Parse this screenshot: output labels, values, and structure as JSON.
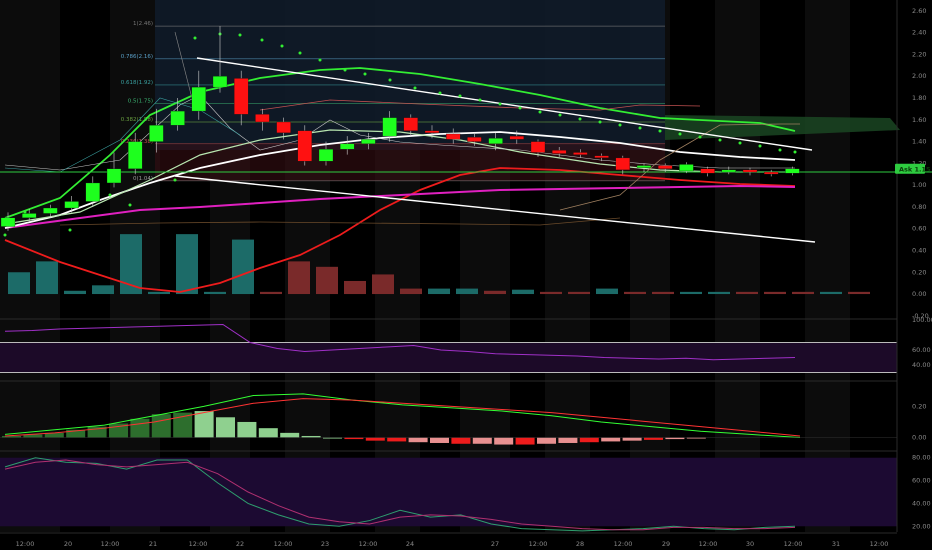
{
  "chart_data": [
    {
      "type": "candlestick",
      "x_ticks": [
        "12:00",
        "20",
        "12:00",
        "21",
        "12:00",
        "22",
        "12:00",
        "23",
        "12:00",
        "24",
        "27",
        "12:00",
        "28",
        "12:00",
        "29",
        "12:00",
        "30",
        "12:00",
        "31",
        "12:00"
      ],
      "y_ticks": [
        "2.60",
        "2.40",
        "2.20",
        "2.00",
        "1.80",
        "1.60",
        "1.40",
        "1.20",
        "1.00",
        "0.80",
        "0.60",
        "0.40",
        "0.20",
        "0.00",
        "-0.20"
      ],
      "ylim": [
        -0.22,
        2.7
      ],
      "candles": [
        {
          "o": 0.62,
          "c": 0.7,
          "h": 0.75,
          "l": 0.58
        },
        {
          "o": 0.7,
          "c": 0.74,
          "h": 0.78,
          "l": 0.66
        },
        {
          "o": 0.74,
          "c": 0.79,
          "h": 0.82,
          "l": 0.7
        },
        {
          "o": 0.79,
          "c": 0.85,
          "h": 0.9,
          "l": 0.75
        },
        {
          "o": 0.85,
          "c": 1.02,
          "h": 1.08,
          "l": 0.8
        },
        {
          "o": 1.02,
          "c": 1.15,
          "h": 1.3,
          "l": 0.98
        },
        {
          "o": 1.15,
          "c": 1.4,
          "h": 1.48,
          "l": 1.1
        },
        {
          "o": 1.4,
          "c": 1.55,
          "h": 1.7,
          "l": 1.3
        },
        {
          "o": 1.55,
          "c": 1.68,
          "h": 1.8,
          "l": 1.5
        },
        {
          "o": 1.68,
          "c": 1.9,
          "h": 2.05,
          "l": 1.6
        },
        {
          "o": 1.9,
          "c": 2.0,
          "h": 2.46,
          "l": 1.85
        },
        {
          "o": 1.98,
          "c": 1.65,
          "h": 2.05,
          "l": 1.55
        },
        {
          "o": 1.65,
          "c": 1.58,
          "h": 1.7,
          "l": 1.5
        },
        {
          "o": 1.58,
          "c": 1.48,
          "h": 1.62,
          "l": 1.42
        },
        {
          "o": 1.5,
          "c": 1.22,
          "h": 1.55,
          "l": 1.18
        },
        {
          "o": 1.22,
          "c": 1.33,
          "h": 1.4,
          "l": 1.18
        },
        {
          "o": 1.33,
          "c": 1.38,
          "h": 1.45,
          "l": 1.28
        },
        {
          "o": 1.38,
          "c": 1.42,
          "h": 1.48,
          "l": 1.33
        },
        {
          "o": 1.45,
          "c": 1.62,
          "h": 1.68,
          "l": 1.4
        },
        {
          "o": 1.62,
          "c": 1.5,
          "h": 1.65,
          "l": 1.45
        },
        {
          "o": 1.5,
          "c": 1.48,
          "h": 1.55,
          "l": 1.43
        },
        {
          "o": 1.47,
          "c": 1.42,
          "h": 1.52,
          "l": 1.38
        },
        {
          "o": 1.44,
          "c": 1.4,
          "h": 1.48,
          "l": 1.36
        },
        {
          "o": 1.38,
          "c": 1.43,
          "h": 1.48,
          "l": 1.32
        },
        {
          "o": 1.45,
          "c": 1.42,
          "h": 1.5,
          "l": 1.38
        },
        {
          "o": 1.4,
          "c": 1.3,
          "h": 1.42,
          "l": 1.26
        },
        {
          "o": 1.32,
          "c": 1.29,
          "h": 1.35,
          "l": 1.26
        },
        {
          "o": 1.3,
          "c": 1.28,
          "h": 1.33,
          "l": 1.25
        },
        {
          "o": 1.27,
          "c": 1.26,
          "h": 1.29,
          "l": 1.22
        },
        {
          "o": 1.25,
          "c": 1.14,
          "h": 1.27,
          "l": 1.1
        },
        {
          "o": 1.16,
          "c": 1.18,
          "h": 1.2,
          "l": 1.12
        },
        {
          "o": 1.18,
          "c": 1.15,
          "h": 1.2,
          "l": 1.12
        },
        {
          "o": 1.13,
          "c": 1.19,
          "h": 1.21,
          "l": 1.11
        },
        {
          "o": 1.15,
          "c": 1.11,
          "h": 1.17,
          "l": 1.08
        },
        {
          "o": 1.12,
          "c": 1.14,
          "h": 1.17,
          "l": 1.1
        },
        {
          "o": 1.14,
          "c": 1.12,
          "h": 1.16,
          "l": 1.09
        },
        {
          "o": 1.12,
          "c": 1.11,
          "h": 1.14,
          "l": 1.08
        },
        {
          "o": 1.11,
          "c": 1.15,
          "h": 1.17,
          "l": 1.09
        }
      ],
      "volume": [
        0.2,
        0.3,
        0.03,
        0.08,
        0.55,
        0.02,
        0.55,
        0.02,
        0.5,
        0.02,
        0.3,
        0.25,
        0.12,
        0.18,
        0.05,
        0.05,
        0.05,
        0.03,
        0.04,
        0.02,
        0.02,
        0.05,
        0.02,
        0.02,
        0.02,
        0.02,
        0.02,
        0.02,
        0.02,
        0.02,
        0.02
      ],
      "volume_up": [
        true,
        true,
        true,
        true,
        true,
        true,
        true,
        true,
        true,
        false,
        false,
        false,
        false,
        false,
        false,
        true,
        true,
        false,
        true,
        false,
        false,
        true,
        false,
        false,
        true,
        true,
        false,
        false,
        false,
        true,
        false
      ],
      "fib_levels": [
        {
          "label": "1(2.46)",
          "value": 2.46
        },
        {
          "label": "0.786(2.16)",
          "value": 2.16
        },
        {
          "label": "0.618(1.92)",
          "value": 1.92
        },
        {
          "label": "0.5(1.75)",
          "value": 1.75
        },
        {
          "label": "0.382(1.58)",
          "value": 1.58
        },
        {
          "label": "0.236(1.38)",
          "value": 1.38
        },
        {
          "label": "0(1.04)",
          "value": 1.04
        }
      ],
      "price_label": "Ask",
      "price_value": "1.15",
      "price_level": 1.15,
      "colors": {
        "up": "#1eff1e",
        "down": "#ff1111",
        "vol_up": "#1c6b68",
        "vol_down": "#7a2a2a",
        "accent": "#26a69a"
      }
    },
    {
      "type": "line",
      "y_ticks": [
        "100.00",
        "60.00",
        "40.00"
      ],
      "ylim": [
        20,
        100
      ],
      "bands": [
        70,
        30
      ],
      "series": [
        {
          "color": "#a030c8",
          "values": [
            85,
            86,
            88,
            89,
            90,
            91,
            92,
            93,
            94,
            70,
            62,
            58,
            60,
            62,
            64,
            66,
            60,
            58,
            55,
            54,
            53,
            52,
            50,
            49,
            48,
            49,
            47,
            48,
            49,
            50
          ]
        }
      ]
    },
    {
      "type": "bar",
      "y_ticks": [
        "0.20",
        "0.00"
      ],
      "ylim": [
        -0.08,
        0.35
      ],
      "histogram": [
        0.01,
        0.02,
        0.03,
        0.05,
        0.07,
        0.09,
        0.12,
        0.15,
        0.16,
        0.17,
        0.13,
        0.1,
        0.06,
        0.03,
        0.01,
        0.0,
        -0.01,
        -0.02,
        -0.025,
        -0.03,
        -0.035,
        -0.04,
        -0.04,
        -0.045,
        -0.045,
        -0.04,
        -0.035,
        -0.03,
        -0.025,
        -0.02,
        -0.015,
        -0.01,
        -0.005
      ],
      "series": [
        {
          "color": "#33ff33",
          "values": [
            0.02,
            0.05,
            0.08,
            0.14,
            0.2,
            0.27,
            0.28,
            0.24,
            0.21,
            0.19,
            0.17,
            0.14,
            0.1,
            0.07,
            0.04,
            0.02,
            0.0
          ]
        },
        {
          "color": "#ff3333",
          "values": [
            0.01,
            0.03,
            0.06,
            0.1,
            0.16,
            0.22,
            0.25,
            0.24,
            0.22,
            0.2,
            0.18,
            0.16,
            0.13,
            0.1,
            0.07,
            0.04,
            0.01
          ]
        }
      ]
    },
    {
      "type": "line",
      "y_ticks": [
        "80.00",
        "60.00",
        "40.00",
        "20.00"
      ],
      "ylim": [
        15,
        85
      ],
      "band": [
        20,
        80
      ],
      "series": [
        {
          "color": "#2e9e6e",
          "values": [
            72,
            80,
            76,
            75,
            70,
            78,
            78,
            58,
            40,
            30,
            22,
            20,
            25,
            34,
            28,
            30,
            22,
            18,
            17,
            16,
            17,
            18,
            20,
            18,
            17,
            19,
            20
          ]
        },
        {
          "color": "#b03070",
          "values": [
            70,
            76,
            78,
            74,
            72,
            74,
            76,
            66,
            50,
            38,
            28,
            24,
            22,
            28,
            30,
            29,
            26,
            22,
            20,
            18,
            17,
            17,
            19,
            19,
            18,
            18,
            19
          ]
        }
      ]
    }
  ]
}
